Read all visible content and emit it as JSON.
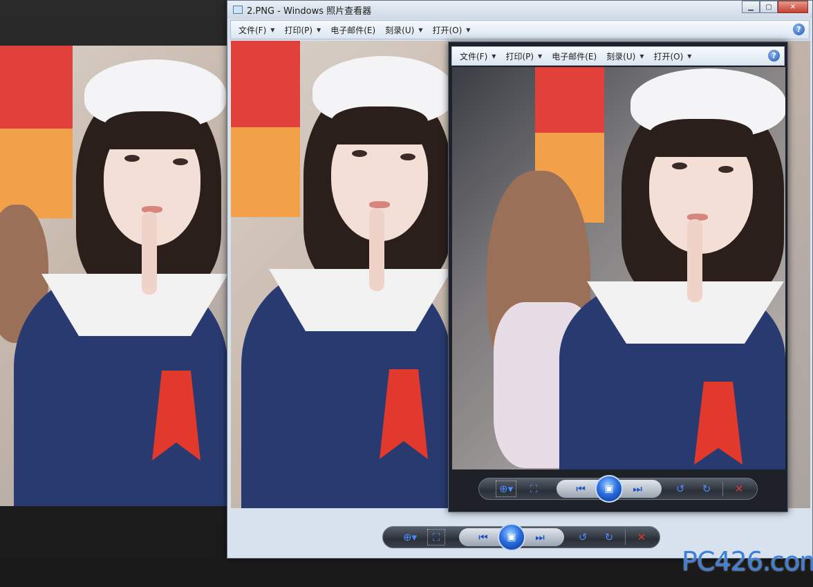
{
  "window_main": {
    "title": "2.PNG - Windows 照片查看器",
    "buttons": {
      "minimize": "▁",
      "maximize": "▢",
      "close": "✕"
    }
  },
  "menus": [
    {
      "label": "文件(F)",
      "has_dropdown": true
    },
    {
      "label": "打印(P)",
      "has_dropdown": true
    },
    {
      "label": "电子邮件(E)",
      "has_dropdown": false
    },
    {
      "label": "刻录(U)",
      "has_dropdown": true
    },
    {
      "label": "打开(O)",
      "has_dropdown": true
    }
  ],
  "help_label": "?",
  "toolbar": {
    "zoom_icon": "magnifier-icon",
    "fit_icon": "actual-size-icon",
    "prev_icon": "previous-icon",
    "slideshow_icon": "slideshow-icon",
    "next_icon": "next-icon",
    "rotate_ccw_icon": "rotate-counterclockwise-icon",
    "rotate_cw_icon": "rotate-clockwise-icon",
    "delete_icon": "delete-icon"
  },
  "glyphs": {
    "zoom": "⊕▾",
    "fit": "⛶",
    "prev": "⏮",
    "slideshow": "▣",
    "next": "⏭",
    "rotate_ccw": "↺",
    "rotate_cw": "↻",
    "delete": "✕",
    "dropdown": "▼"
  },
  "watermark": "PC426.com",
  "colors": {
    "accent_blue": "#1d52c4",
    "delete_red": "#e0382c"
  }
}
